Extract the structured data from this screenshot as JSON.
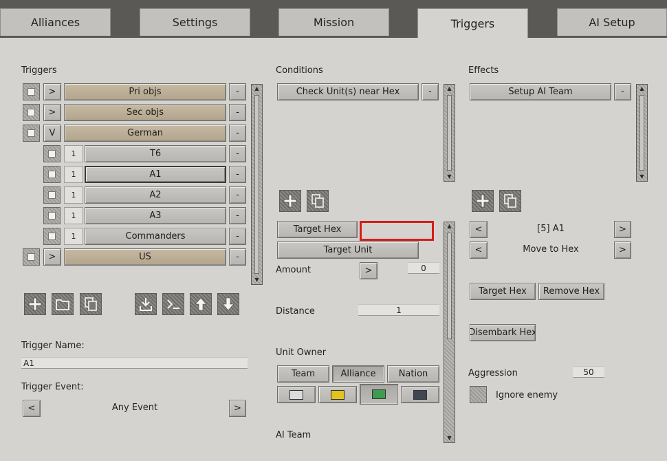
{
  "tabs": [
    {
      "label": "Alliances"
    },
    {
      "label": "Settings"
    },
    {
      "label": "Mission"
    },
    {
      "label": "Triggers"
    },
    {
      "label": "AI Setup"
    }
  ],
  "triggers_panel": {
    "title": "Triggers",
    "rows": [
      {
        "toggle": ">",
        "label": "Pri objs",
        "remove": "-"
      },
      {
        "toggle": ">",
        "label": "Sec objs",
        "remove": "-"
      },
      {
        "toggle": "V",
        "label": "German",
        "remove": "-"
      },
      {
        "count": "1",
        "label": "T6",
        "remove": "-"
      },
      {
        "count": "1",
        "label": "A1",
        "remove": "-"
      },
      {
        "count": "1",
        "label": "A2",
        "remove": "-"
      },
      {
        "count": "1",
        "label": "A3",
        "remove": "-"
      },
      {
        "count": "1",
        "label": "Commanders",
        "remove": "-"
      },
      {
        "toggle": ">",
        "label": "US",
        "remove": "-"
      }
    ],
    "trigger_name_label": "Trigger Name:",
    "trigger_name_value": "A1",
    "trigger_event_label": "Trigger Event:",
    "trigger_event_value": "Any Event",
    "prev": "<",
    "next": ">"
  },
  "conditions_panel": {
    "title": "Conditions",
    "item": "Check Unit(s) near Hex",
    "remove": "-",
    "target_hex": "Target Hex",
    "target_unit": "Target Unit",
    "amount_label": "Amount",
    "amount_arrow": ">",
    "amount_value": "0",
    "distance_label": "Distance",
    "distance_value": "1",
    "unit_owner_label": "Unit Owner",
    "owner_buttons": [
      "Team",
      "Alliance",
      "Nation"
    ],
    "ai_team_label": "AI Team"
  },
  "effects_panel": {
    "title": "Effects",
    "item": "Setup AI Team",
    "remove": "-",
    "team_prev": "<",
    "team_value": "[5] A1",
    "team_next": ">",
    "action_prev": "<",
    "action_value": "Move to Hex",
    "action_next": ">",
    "target_hex": "Target Hex",
    "remove_hex": "Remove Hex",
    "disembark_hex": "Disembark Hex",
    "aggression_label": "Aggression",
    "aggression_value": "50",
    "ignore_enemy": "Ignore enemy"
  },
  "colors": {
    "swatch_white": "#dcdcdc",
    "swatch_yellow": "#e2c41c",
    "swatch_green": "#3f9a52",
    "swatch_dark": "#3e4553",
    "highlight_box": "#d81a1a"
  },
  "icons": [
    "plus-icon",
    "folder-icon",
    "copy-icon",
    "import-icon",
    "console-icon",
    "arrow-up-icon",
    "arrow-down-icon"
  ]
}
